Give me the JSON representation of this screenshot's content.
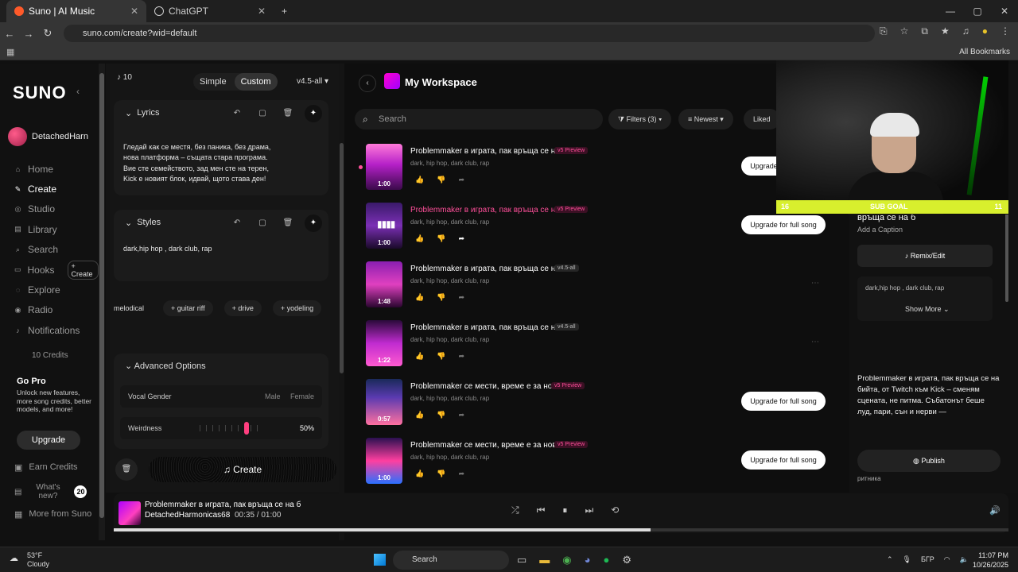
{
  "browser": {
    "tabs": [
      {
        "title": "Suno | AI Music",
        "active": true
      },
      {
        "title": "ChatGPT",
        "active": false
      }
    ],
    "url": "suno.com/create?wid=default",
    "bookmarks_label": "All Bookmarks"
  },
  "nav": {
    "logo": "SUNO",
    "username": "DetachedHarn",
    "items": [
      {
        "label": "Home",
        "icon": "home-icon"
      },
      {
        "label": "Create",
        "icon": "create-icon"
      },
      {
        "label": "Studio",
        "icon": "studio-icon"
      },
      {
        "label": "Library",
        "icon": "library-icon"
      },
      {
        "label": "Search",
        "icon": "search-icon"
      },
      {
        "label": "Hooks",
        "icon": "hooks-icon"
      },
      {
        "label": "Explore",
        "icon": "explore-icon"
      },
      {
        "label": "Radio",
        "icon": "radio-icon"
      },
      {
        "label": "Notifications",
        "icon": "bell-icon"
      }
    ],
    "hooks_create": "+ Create",
    "credits": "10 Credits",
    "gopro_title": "Go Pro",
    "gopro_text": "Unlock new features, more song credits, better models, and more!",
    "upgrade": "Upgrade",
    "earn": "Earn Credits",
    "whats_new": "What's new?",
    "whats_new_count": "20",
    "more_from": "More from Suno"
  },
  "create": {
    "count": "10",
    "mode_simple": "Simple",
    "mode_custom": "Custom",
    "version": "v4.5-all",
    "lyrics_label": "Lyrics",
    "lyrics_text": "Гледай как се местя, без паника, без драма, нова платформа – същата стара програма. Вие сте семейството, зад мен сте на терен, Kick е новият блок, идвай, щото става ден!",
    "styles_label": "Styles",
    "styles_text": "dark,hip hop , dark club, rap",
    "tags": [
      "melodical",
      "+ guitar riff",
      "+ drive",
      "+ yodeling"
    ],
    "advanced": "Advanced Options",
    "vocal_gender": "Vocal Gender",
    "male": "Male",
    "female": "Female",
    "weirdness": "Weirdness",
    "weirdness_value": "50%",
    "create_button": "Create"
  },
  "workspace": {
    "title": "My Workspace",
    "search_placeholder": "Search",
    "filters": "Filters (3)",
    "sort": "Newest",
    "liked": "Liked",
    "songs": [
      {
        "title": "Problemmaker в играта, пак връща се на б",
        "badge": "v5 Preview",
        "badge_type": "prev",
        "tags": "dark, hip hop, dark club, rap",
        "duration": "1:00",
        "upgrade": "Upgrade for full song",
        "pink_title": false
      },
      {
        "title": "Problemmaker в играта, пак връща се на б",
        "badge": "v5 Preview",
        "badge_type": "prev",
        "tags": "dark, hip hop, dark club, rap",
        "duration": "1:00",
        "upgrade": "Upgrade for full song",
        "pink_title": true
      },
      {
        "title": "Problemmaker в играта, пак връща се на б",
        "badge": "v4.5-all",
        "badge_type": "all",
        "tags": "dark, hip hop, dark club, rap",
        "duration": "1:48",
        "upgrade": "",
        "pink_title": false
      },
      {
        "title": "Problemmaker в играта, пак връща се на б",
        "badge": "v4.5-all",
        "badge_type": "all",
        "tags": "dark, hip hop, dark club, rap",
        "duration": "1:22",
        "upgrade": "",
        "pink_title": false
      },
      {
        "title": "Problemmaker се мести, време е за нов ст",
        "badge": "v5 Preview",
        "badge_type": "prev",
        "tags": "dark, hip hop, dark club, rap",
        "duration": "0:57",
        "upgrade": "Upgrade for full song",
        "pink_title": false
      },
      {
        "title": "Problemmaker се мести, време е за нов ст",
        "badge": "v5 Preview",
        "badge_type": "prev",
        "tags": "dark, hip hop, dark club, rap",
        "duration": "1:00",
        "upgrade": "Upgrade for full song",
        "pink_title": false
      }
    ]
  },
  "detail": {
    "title": "връща се на б",
    "caption": "Add a Caption",
    "remix": "Remix/Edit",
    "tags": "dark,hip hop , dark club, rap",
    "show_more": "Show More",
    "lyrics": "Problemmaker в играта, пак връща се на бийта, от Twitch към Kick – сменям сцената, не питма. Събатонът беше луд, пари, сън и нерви —",
    "publish": "Publish",
    "under": "ритника"
  },
  "overlay": {
    "left": "16",
    "label": "SUB GOAL",
    "right": "11"
  },
  "player": {
    "title": "Problemmaker в играта, пак връща се на б",
    "artist": "DetachedHarmonicas68",
    "time": "00:35 / 01:00",
    "progress": 0.6
  },
  "taskbar": {
    "temp": "53°F",
    "weather": "Cloudy",
    "search": "Search",
    "lang": "БГР",
    "time": "11:07 PM",
    "date": "10/26/2025"
  }
}
